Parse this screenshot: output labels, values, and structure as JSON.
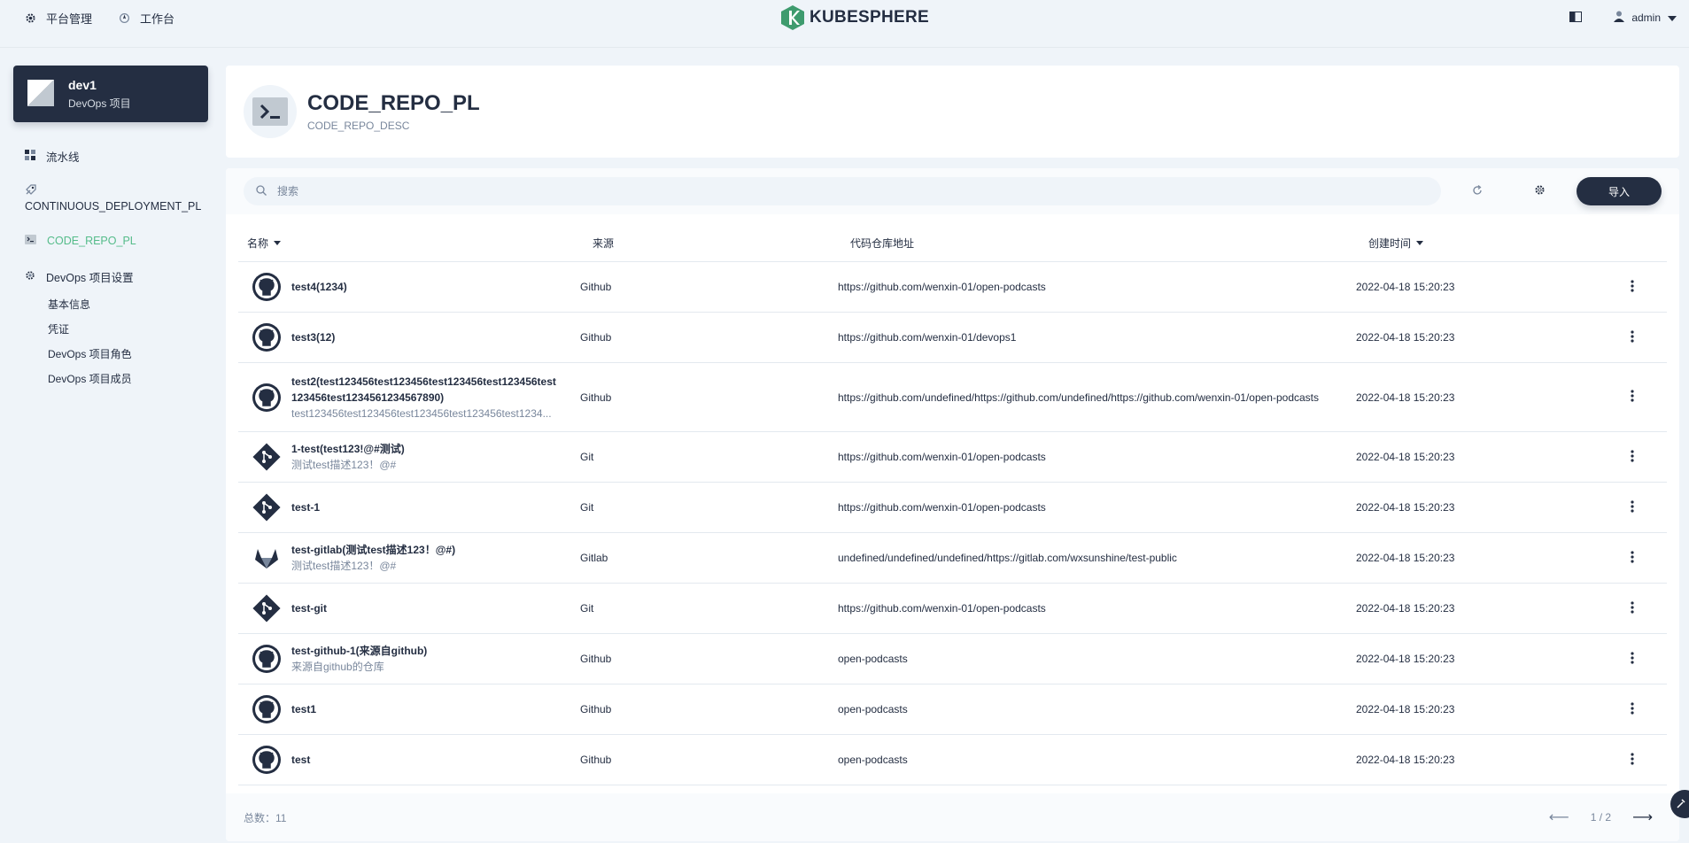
{
  "topbar": {
    "nav": [
      {
        "label": "平台管理",
        "icon": "gear-icon"
      },
      {
        "label": "工作台",
        "icon": "workbench-icon"
      }
    ],
    "logo_text": "KUBESPHERE",
    "user_name": "admin"
  },
  "sidebar": {
    "project_name": "dev1",
    "project_type": "DevOps 项目",
    "items": [
      {
        "label": "流水线",
        "icon": "pipeline-icon"
      },
      {
        "label": "CONTINUOUS_DEPLOYMENT_PL",
        "icon": "rocket-icon"
      },
      {
        "label": "CODE_REPO_PL",
        "icon": "terminal-icon"
      },
      {
        "label": "DevOps 项目设置",
        "icon": "gear-icon"
      }
    ],
    "settings_sub": [
      "基本信息",
      "凭证",
      "DevOps 项目角色",
      "DevOps 项目成员"
    ]
  },
  "header": {
    "title": "CODE_REPO_PL",
    "desc": "CODE_REPO_DESC"
  },
  "toolbar": {
    "search_placeholder": "搜索",
    "import_label": "导入"
  },
  "table": {
    "columns": {
      "name": "名称",
      "source": "来源",
      "url": "代码仓库地址",
      "created": "创建时间"
    },
    "rows": [
      {
        "name": "test4(1234)",
        "desc": "",
        "source": "Github",
        "url": "https://github.com/wenxin-01/open-podcasts",
        "created": "2022-04-18 15:20:23",
        "icon": "github-icon"
      },
      {
        "name": "test3(12)",
        "desc": "",
        "source": "Github",
        "url": "https://github.com/wenxin-01/devops1",
        "created": "2022-04-18 15:20:23",
        "icon": "github-icon"
      },
      {
        "name": "test2(test123456test123456test123456test123456test123456test1234561234567890)",
        "desc": "test123456test123456test123456test123456test1234...",
        "source": "Github",
        "url": "https://github.com/undefined/https://github.com/undefined/https://github.com/wenxin-01/open-podcasts",
        "created": "2022-04-18 15:20:23",
        "icon": "github-icon"
      },
      {
        "name": "1-test(test123!@#测试)",
        "desc": "测试test描述123！@#",
        "source": "Git",
        "url": "https://github.com/wenxin-01/open-podcasts",
        "created": "2022-04-18 15:20:23",
        "icon": "git-icon"
      },
      {
        "name": "test-1",
        "desc": "",
        "source": "Git",
        "url": "https://github.com/wenxin-01/open-podcasts",
        "created": "2022-04-18 15:20:23",
        "icon": "git-icon"
      },
      {
        "name": "test-gitlab(测试test描述123！@#)",
        "desc": "测试test描述123！@#",
        "source": "Gitlab",
        "url": "undefined/undefined/undefined/https://gitlab.com/wxsunshine/test-public",
        "created": "2022-04-18 15:20:23",
        "icon": "gitlab-icon"
      },
      {
        "name": "test-git",
        "desc": "",
        "source": "Git",
        "url": "https://github.com/wenxin-01/open-podcasts",
        "created": "2022-04-18 15:20:23",
        "icon": "git-icon"
      },
      {
        "name": "test-github-1(来源自github)",
        "desc": "来源自github的仓库",
        "source": "Github",
        "url": "open-podcasts",
        "created": "2022-04-18 15:20:23",
        "icon": "github-icon"
      },
      {
        "name": "test1",
        "desc": "",
        "source": "Github",
        "url": "open-podcasts",
        "created": "2022-04-18 15:20:23",
        "icon": "github-icon"
      },
      {
        "name": "test",
        "desc": "",
        "source": "Github",
        "url": "open-podcasts",
        "created": "2022-04-18 15:20:23",
        "icon": "github-icon"
      }
    ]
  },
  "footer": {
    "total_label": "总数：11",
    "page_label": "1 / 2"
  },
  "colors": {
    "accent": "#55bc8a",
    "dark": "#242e42",
    "muted": "#79879c",
    "background": "#eff4f9"
  }
}
